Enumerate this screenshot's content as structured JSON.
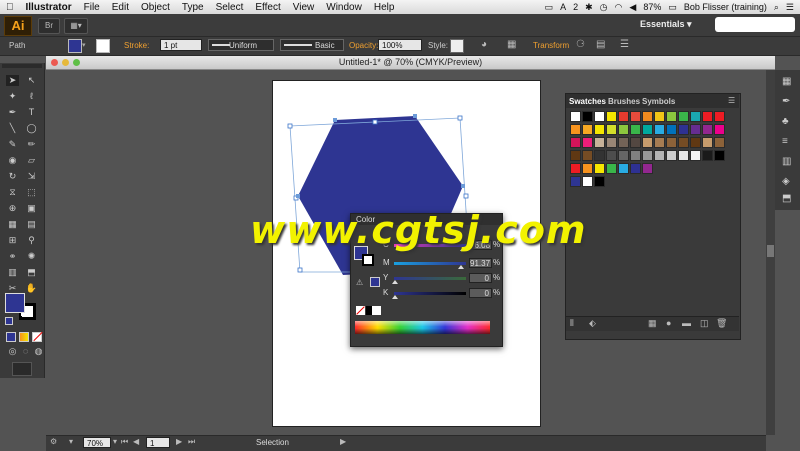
{
  "menubar": {
    "apple": "",
    "app_name": "Illustrator",
    "items": [
      "File",
      "Edit",
      "Object",
      "Type",
      "Select",
      "Effect",
      "View",
      "Window",
      "Help"
    ],
    "status_count": "2",
    "battery": "87%",
    "user": "Bob Flisser (training)"
  },
  "appbar": {
    "logo": "Ai",
    "bridge": "Br",
    "arrange": "▦▾",
    "workspace": "Essentials ▾"
  },
  "control": {
    "selection_type": "Path",
    "stroke_label": "Stroke:",
    "stroke_value": "1 pt",
    "profile_uniform": "Uniform",
    "brush_basic": "Basic",
    "opacity_label": "Opacity:",
    "opacity_value": "100%",
    "style_label": "Style:",
    "transform_label": "Transform"
  },
  "document": {
    "title": "Untitled-1* @ 70% (CMYK/Preview)"
  },
  "status": {
    "zoom": "70%",
    "page": "1",
    "tool_name": "Selection"
  },
  "color_panel": {
    "title": "Color",
    "rows": [
      {
        "label": "C",
        "value": "96.08",
        "unit": "%",
        "level": 0.96
      },
      {
        "label": "M",
        "value": "91.37",
        "unit": "%",
        "level": 0.91
      },
      {
        "label": "Y",
        "value": "0",
        "unit": "%",
        "level": 0
      },
      {
        "label": "K",
        "value": "0",
        "unit": "%",
        "level": 0
      }
    ],
    "fill_color": "#2e3592"
  },
  "swatches": {
    "tabs": [
      "Swatches",
      "Brushes",
      "Symbols"
    ],
    "rows": [
      [
        "#ffffff",
        "#000000",
        "#ffffff",
        "#f5e600",
        "#e63b2e",
        "#e64b3c",
        "#f08a1f",
        "#f2c417",
        "#8cc63e",
        "#3ab54a",
        "#1aa7b0",
        "#ed1c24",
        "#ed1c24"
      ],
      [
        "#f7931e",
        "#f7a823",
        "#f5e600",
        "#d4df2a",
        "#8cc63e",
        "#39b54a",
        "#00a99d",
        "#29abe2",
        "#0071bc",
        "#2e3192",
        "#662d91",
        "#92278f",
        "#ec008c"
      ],
      [
        "#d4145a",
        "#ed1e79",
        "#c7b299",
        "#998675",
        "#736357",
        "#534741",
        "#c69c6d",
        "#a67c52",
        "#8c6239",
        "#754c24",
        "#603813",
        "#c69c6d",
        "#8c6239"
      ],
      [
        "#603813",
        "#754c24",
        "#333333",
        "#4d4d4d",
        "#666666",
        "#808080",
        "#999999",
        "#b3b3b3",
        "#cccccc",
        "#e6e6e6",
        "#f2f2f2",
        "#1a1a1a",
        "#000000"
      ],
      [
        "#ed1c24",
        "#f7931e",
        "#f5e600",
        "#39b54a",
        "#29abe2",
        "#2e3192",
        "#92278f"
      ],
      [
        "#2e3592",
        "#ffffff",
        "#000000"
      ]
    ]
  },
  "watermark": "www.cgtsj.com",
  "colors": {
    "hexagon": "#2e3592",
    "accent": "#f0a030"
  }
}
